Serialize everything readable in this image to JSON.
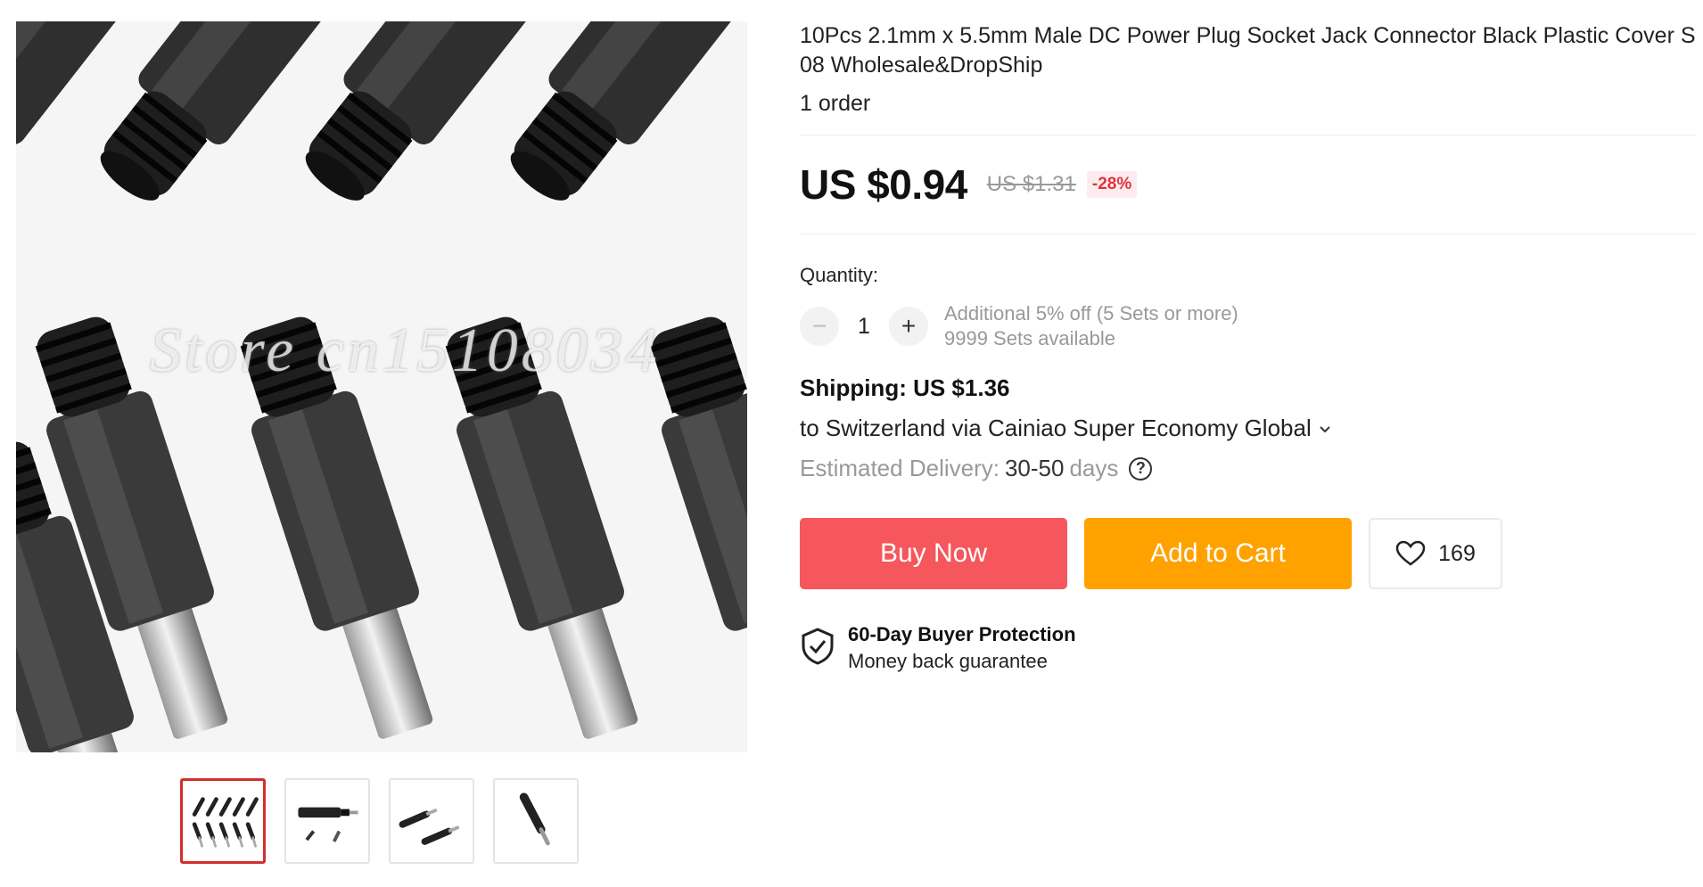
{
  "product": {
    "title": "10Pcs 2.1mm x 5.5mm Male DC Power Plug Socket Jack Connector Black Plastic Cover S",
    "title_line2": "08 Wholesale&DropShip",
    "orders": "1 order"
  },
  "gallery": {
    "watermark": "Store cn15108034",
    "thumbnails": [
      "thumb-many-plugs",
      "thumb-plug-with-parts",
      "thumb-two-plugs",
      "thumb-single-plug"
    ],
    "active_index": 0
  },
  "price": {
    "current": "US $0.94",
    "original": "US $1.31",
    "discount": "-28%"
  },
  "quantity": {
    "label": "Quantity:",
    "value": "1",
    "minus_glyph": "−",
    "plus_glyph": "+",
    "promo": "Additional 5% off (5 Sets or more)",
    "available": "9999 Sets available"
  },
  "shipping": {
    "cost": "Shipping: US $1.36",
    "route": "to Switzerland via Cainiao Super Economy Global",
    "delivery_label": "Estimated Delivery:",
    "delivery_range": "30-50",
    "delivery_unit": "days",
    "help_glyph": "?"
  },
  "actions": {
    "buy_now": "Buy Now",
    "add_to_cart": "Add to Cart",
    "wishlist_count": "169"
  },
  "protection": {
    "title": "60-Day Buyer Protection",
    "subtitle": "Money back guarantee"
  },
  "colors": {
    "buy_now": "#f5575c",
    "add_to_cart": "#ffa200",
    "discount": "#e0323c",
    "active_thumb": "#d32f2f"
  }
}
